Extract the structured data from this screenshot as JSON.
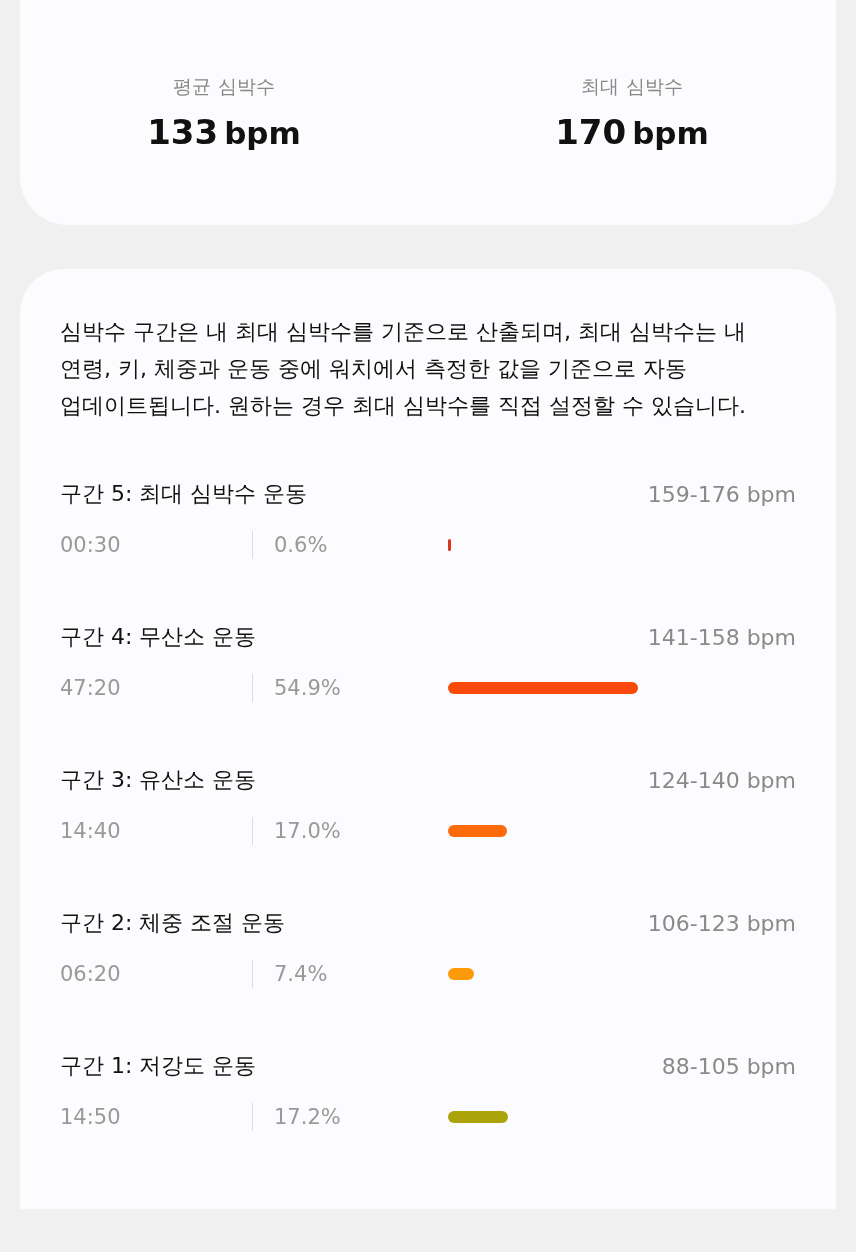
{
  "summary": [
    {
      "label": "평균 심박수",
      "value": "133",
      "unit": "bpm"
    },
    {
      "label": "최대 심박수",
      "value": "170",
      "unit": "bpm"
    }
  ],
  "description": "심박수 구간은 내 최대 심박수를 기준으로 산출되며, 최대 심박수는 내 연령, 키, 체중과 운동 중에 워치에서 측정한 값을 기준으로 자동 업데이트됩니다. 원하는 경우 최대 심박수를 직접 설정할 수 있습니다.",
  "zones": [
    {
      "name": "구간 5: 최대 심박수 운동",
      "range": "159-176 bpm",
      "time": "00:30",
      "percent": "0.6%",
      "color": "#d83a1e"
    },
    {
      "name": "구간 4: 무산소 운동",
      "range": "141-158 bpm",
      "time": "47:20",
      "percent": "54.9%",
      "color": "#fa4a0a"
    },
    {
      "name": "구간 3: 유산소 운동",
      "range": "124-140 bpm",
      "time": "14:40",
      "percent": "17.0%",
      "color": "#fd6a0a"
    },
    {
      "name": "구간 2: 체중 조절 운동",
      "range": "106-123 bpm",
      "time": "06:20",
      "percent": "7.4%",
      "color": "#fd9a0a"
    },
    {
      "name": "구간 1: 저강도 운동",
      "range": "88-105 bpm",
      "time": "14:50",
      "percent": "17.2%",
      "color": "#aca20a"
    }
  ]
}
